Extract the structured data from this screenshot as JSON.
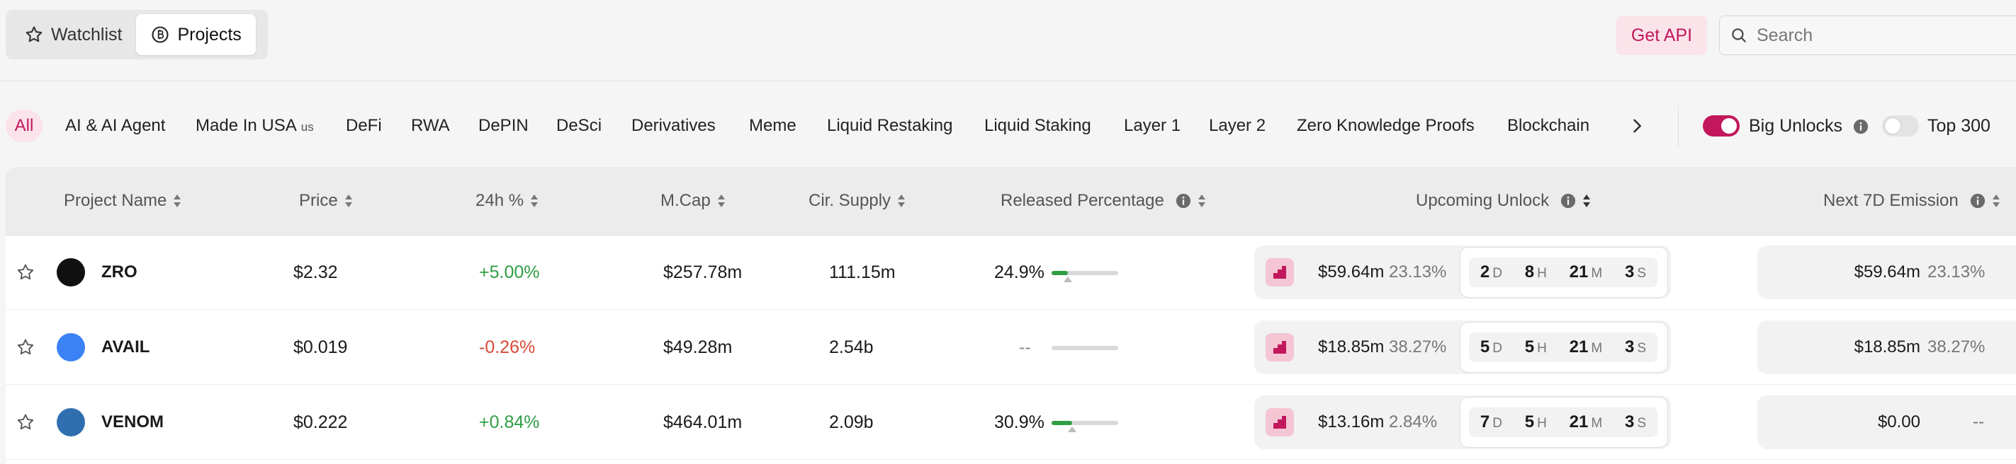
{
  "tabs": {
    "watchlist_label": "Watchlist",
    "projects_label": "Projects",
    "active": "Projects"
  },
  "header": {
    "get_api_label": "Get API",
    "search_placeholder": "Search"
  },
  "categories": [
    {
      "label": "All",
      "active": true
    },
    {
      "label": "AI & AI Agent"
    },
    {
      "label": "Made In USA",
      "suffix": "us"
    },
    {
      "label": "DeFi"
    },
    {
      "label": "RWA"
    },
    {
      "label": "DePIN"
    },
    {
      "label": "DeSci"
    },
    {
      "label": "Derivatives"
    },
    {
      "label": "Meme"
    },
    {
      "label": "Liquid Restaking"
    },
    {
      "label": "Liquid Staking"
    },
    {
      "label": "Layer 1"
    },
    {
      "label": "Layer 2"
    },
    {
      "label": "Zero Knowledge Proofs"
    },
    {
      "label": "Blockchain"
    }
  ],
  "filters": {
    "big_unlocks_label": "Big Unlocks",
    "big_unlocks_on": true,
    "top300_label": "Top 300",
    "top300_on": false
  },
  "columns": {
    "project_name": "Project Name",
    "price": "Price",
    "change_24h": "24h %",
    "mcap": "M.Cap",
    "cir_supply": "Cir. Supply",
    "released_percentage": "Released Percentage",
    "upcoming_unlock": "Upcoming Unlock",
    "next_7d_emission": "Next 7D Emission"
  },
  "rows": [
    {
      "name": "ZRO",
      "price": "$2.32",
      "change": "+5.00%",
      "direction": "up",
      "mcap": "$257.78m",
      "supply": "111.15m",
      "released": "24.9%",
      "released_fraction": 0.249,
      "unlock_value": "$59.64m",
      "unlock_pct": "23.13%",
      "timer": {
        "d": "2",
        "h": "8",
        "m": "21",
        "s": "3"
      },
      "emission_value": "$59.64m",
      "emission_pct": "23.13%",
      "logo_color": "#111111"
    },
    {
      "name": "AVAIL",
      "price": "$0.019",
      "change": "-0.26%",
      "direction": "down",
      "mcap": "$49.28m",
      "supply": "2.54b",
      "released": "--",
      "released_fraction": 0,
      "unlock_value": "$18.85m",
      "unlock_pct": "38.27%",
      "timer": {
        "d": "5",
        "h": "5",
        "m": "21",
        "s": "3"
      },
      "emission_value": "$18.85m",
      "emission_pct": "38.27%",
      "logo_color": "#3b82f6"
    },
    {
      "name": "VENOM",
      "price": "$0.222",
      "change": "+0.84%",
      "direction": "up",
      "mcap": "$464.01m",
      "supply": "2.09b",
      "released": "30.9%",
      "released_fraction": 0.309,
      "unlock_value": "$13.16m",
      "unlock_pct": "2.84%",
      "timer": {
        "d": "7",
        "h": "5",
        "m": "21",
        "s": "3"
      },
      "emission_value": "$0.00",
      "emission_pct": "--",
      "logo_color": "#2f6fb0"
    }
  ],
  "timer_units": {
    "d": "D",
    "h": "H",
    "m": "M",
    "s": "S"
  }
}
